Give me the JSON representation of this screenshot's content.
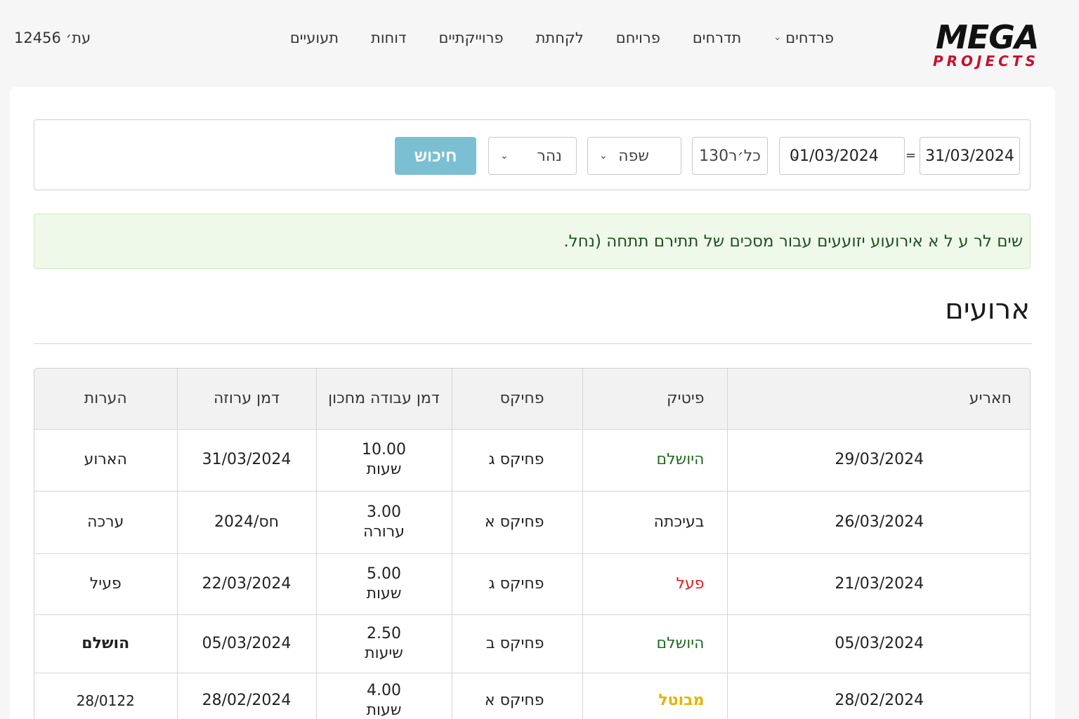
{
  "header": {
    "logo": {
      "top": "MEGA",
      "bottom": "PROJECTS"
    },
    "nav": [
      {
        "label": "תעועיים"
      },
      {
        "label": "דוחות"
      },
      {
        "label": "פרוייקתיים"
      },
      {
        "label": "לקחתת"
      },
      {
        "label": "פרויחם"
      },
      {
        "label": "תדרחים"
      },
      {
        "label": "פרדחים",
        "has_dropdown": true
      }
    ],
    "user": "עת׳ 12456"
  },
  "filters": {
    "date_to": "31/03/2024",
    "separator": "=",
    "date_from": "01/03/2024",
    "number_value": "כל׳ר130",
    "shift_value": "שפה",
    "river_value": "נהר",
    "search_label": "חיכוש"
  },
  "alert": {
    "text": "שים לר ע ל א אירועוע יזועעים עבור מסכים של תתירם תתחה (נחל."
  },
  "section": {
    "title": "ארועים"
  },
  "table": {
    "columns": [
      "חאריע",
      "פיטיק",
      "פחיקס",
      "דמן עבודה מחכון",
      "דמן ערוזה",
      "הערות"
    ],
    "rows": [
      {
        "date": "29/03/2024",
        "status": "היושלם",
        "status_kind": "completed",
        "fix": "פחיקס ג",
        "work_value": "10.00",
        "work_unit": "שעות",
        "avail": "31/03/2024",
        "notes": "הארוע"
      },
      {
        "date": "26/03/2024",
        "status": "בעיכתה",
        "status_kind": "progress",
        "fix": "פחיקס א",
        "work_value": "3.00",
        "work_unit": "ערורה",
        "avail": "חס/2024",
        "notes": "ערכה"
      },
      {
        "date": "21/03/2024",
        "status": "פעל",
        "status_kind": "active",
        "fix": "פחיקס ג",
        "work_value": "5.00",
        "work_unit": "שעות",
        "avail": "22/03/2024",
        "notes": "פעיל"
      },
      {
        "date": "05/03/2024",
        "status": "היושלם",
        "status_kind": "completed",
        "fix": "פחיקס ב",
        "work_value": "2.50",
        "work_unit": "שיעות",
        "avail": "05/03/2024",
        "notes": "הושלם"
      },
      {
        "date": "28/02/2024",
        "status": "מבוטל",
        "status_kind": "canceled",
        "fix": "פחיקס א",
        "work_value": "4.00",
        "work_unit": "שעות",
        "avail": "28/02/2024",
        "notes": "28/0122"
      }
    ]
  }
}
